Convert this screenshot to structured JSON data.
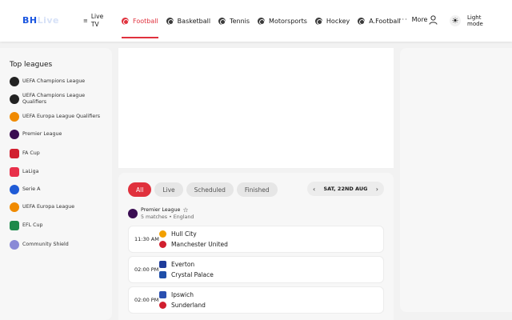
{
  "header": {
    "logo_bold": "BH",
    "logo_rest": "Live",
    "live_tv": [
      "Live",
      "TV"
    ],
    "nav": [
      {
        "label": "Football",
        "icon": "football-icon",
        "active": true
      },
      {
        "label": "Basketball",
        "icon": "basketball-icon",
        "active": false
      },
      {
        "label": "Tennis",
        "icon": "tennis-icon",
        "active": false
      },
      {
        "label": "Motorsports",
        "icon": "motorsports-icon",
        "active": false
      },
      {
        "label": "Hockey",
        "icon": "hockey-icon",
        "active": false
      },
      {
        "label": "A.Football",
        "icon": "american-football-icon",
        "active": false
      }
    ],
    "more_label": "More",
    "theme_label": [
      "Light",
      "mode"
    ]
  },
  "sidebar": {
    "title": "Top leagues",
    "leagues": [
      {
        "label": "UEFA Champions League",
        "icon": "champions-league-icon",
        "color": "#222222"
      },
      {
        "label": "UEFA Champions League Qualifiers",
        "icon": "champions-league-qualifiers-icon",
        "color": "#222222"
      },
      {
        "label": "UEFA Europa League Qualifiers",
        "icon": "europa-league-qualifiers-icon",
        "color": "#f08a00"
      },
      {
        "label": "Premier League",
        "icon": "premier-league-icon",
        "color": "#3a0d52"
      },
      {
        "label": "FA Cup",
        "icon": "fa-cup-icon",
        "color": "#d11f2f"
      },
      {
        "label": "LaLiga",
        "icon": "laliga-icon",
        "color": "#e8304a"
      },
      {
        "label": "Serie A",
        "icon": "serie-a-icon",
        "color": "#1f5bd6"
      },
      {
        "label": "UEFA Europa League",
        "icon": "europa-league-icon",
        "color": "#f08a00"
      },
      {
        "label": "EFL Cup",
        "icon": "efl-cup-icon",
        "color": "#1d8a4a"
      },
      {
        "label": "Community Shield",
        "icon": "community-shield-icon",
        "color": "#8a8ad6"
      }
    ]
  },
  "filters": [
    "All",
    "Live",
    "Scheduled",
    "Finished"
  ],
  "active_filter": "All",
  "date_label": "SAT, 22ND AUG",
  "competition": {
    "name": "Premier League",
    "meta": "5 matches • England"
  },
  "matches": [
    {
      "time": "11:30 AM",
      "home": "Hull City",
      "away": "Manchester United",
      "home_color": "#f2a000",
      "away_color": "#d11f2f"
    },
    {
      "time": "02:00 PM",
      "home": "Everton",
      "away": "Crystal Palace",
      "home_color": "#1f3c9a",
      "away_color": "#1f4ea8"
    },
    {
      "time": "02:00 PM",
      "home": "Ipswich",
      "away": "Sunderland",
      "home_color": "#2a4fb0",
      "away_color": "#d11f2f"
    }
  ],
  "colors": {
    "accent": "#e0313d",
    "brand": "#1a56e0"
  }
}
